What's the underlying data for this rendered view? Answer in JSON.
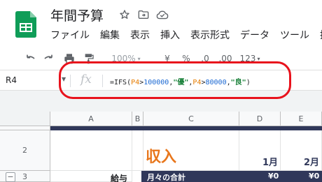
{
  "doc": {
    "title": "年間予算",
    "icons": [
      "star-icon",
      "move-to-folder-icon",
      "cloud-saved-icon"
    ]
  },
  "menu": [
    "ファイル",
    "編集",
    "表示",
    "挿入",
    "表示形式",
    "データ",
    "ツール",
    "拡"
  ],
  "toolbar": {
    "zoom": "100%",
    "currency": "¥",
    "percent": "%",
    "decrease_decimal": ".0",
    "increase_decimal": ".00",
    "format_more": "123"
  },
  "formula_bar": {
    "cell_ref": "R4",
    "fx": "fx",
    "formula_parts": [
      {
        "text": "=IFS(",
        "color": "black"
      },
      {
        "text": "P4",
        "color": "orange"
      },
      {
        "text": ">",
        "color": "black"
      },
      {
        "text": "100000",
        "color": "blue"
      },
      {
        "text": ",",
        "color": "black"
      },
      {
        "text": "\"優\"",
        "color": "green"
      },
      {
        "text": ",",
        "color": "black"
      },
      {
        "text": "P4",
        "color": "orange"
      },
      {
        "text": ">",
        "color": "black"
      },
      {
        "text": "80000",
        "color": "blue"
      },
      {
        "text": ",",
        "color": "black"
      },
      {
        "text": "\"良\"",
        "color": "green"
      },
      {
        "text": ")",
        "color": "black"
      }
    ]
  },
  "grid": {
    "columns": [
      "A",
      "B",
      "C",
      "D",
      "E"
    ],
    "rows": [
      "2",
      "3"
    ],
    "row2": {
      "income": "収入",
      "month1": "1月",
      "month2": "2月"
    },
    "row3": {
      "label": "給与",
      "dark_label": "月々の合計",
      "value_d": "¥0",
      "value_e": "¥0"
    }
  },
  "colors": {
    "header_navy": "#30385a",
    "income_orange": "#e8761b",
    "highlight_red": "#e8121c",
    "sheets_green": "#0f9d58"
  }
}
